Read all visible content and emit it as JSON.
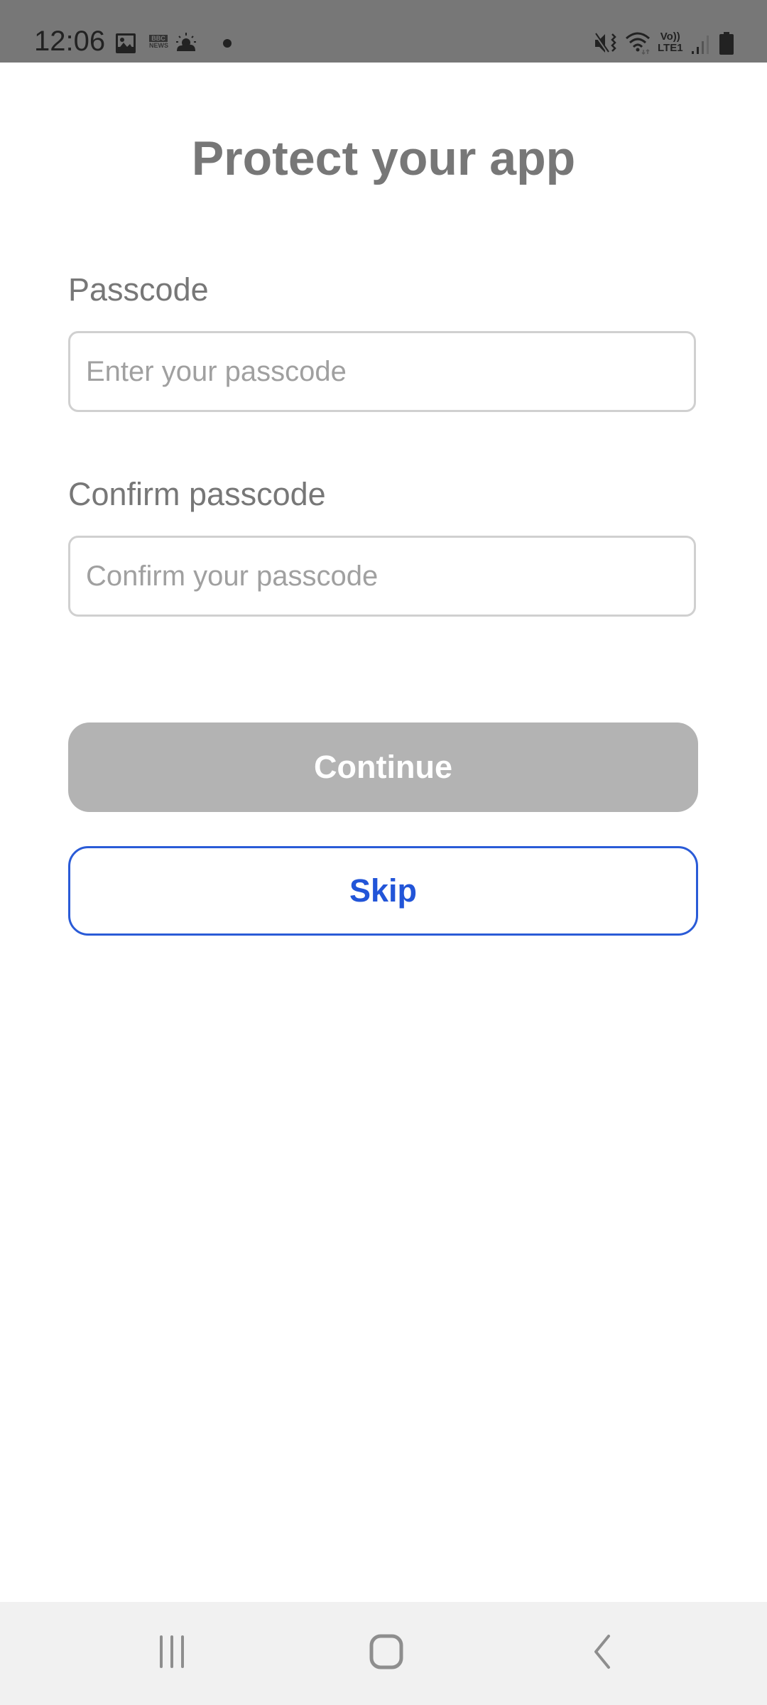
{
  "status_bar": {
    "time": "12:06",
    "left_icons": [
      "gallery-icon",
      "bbc-news-icon",
      "weather-icon",
      "notification-dot-icon"
    ],
    "right_icons": [
      "mute-vibrate-icon",
      "wifi-icon",
      "volte-lte1-icon",
      "signal-icon",
      "battery-icon"
    ],
    "volte_top": "Vo))",
    "volte_bottom": "LTE1",
    "news_top": "BBC",
    "news_bottom": "NEWS"
  },
  "page": {
    "title": "Protect your app"
  },
  "form": {
    "passcode": {
      "label": "Passcode",
      "value": "",
      "placeholder": "Enter your passcode"
    },
    "confirm_passcode": {
      "label": "Confirm passcode",
      "value": "",
      "placeholder": "Confirm your passcode"
    }
  },
  "buttons": {
    "continue_label": "Continue",
    "continue_state": "disabled",
    "skip_label": "Skip"
  },
  "colors": {
    "accent": "#2a5bd7",
    "disabled_button": "#b3b3b3",
    "text_gray": "#777777"
  },
  "nav_bar": {
    "buttons": [
      "recent-apps",
      "home",
      "back"
    ]
  }
}
